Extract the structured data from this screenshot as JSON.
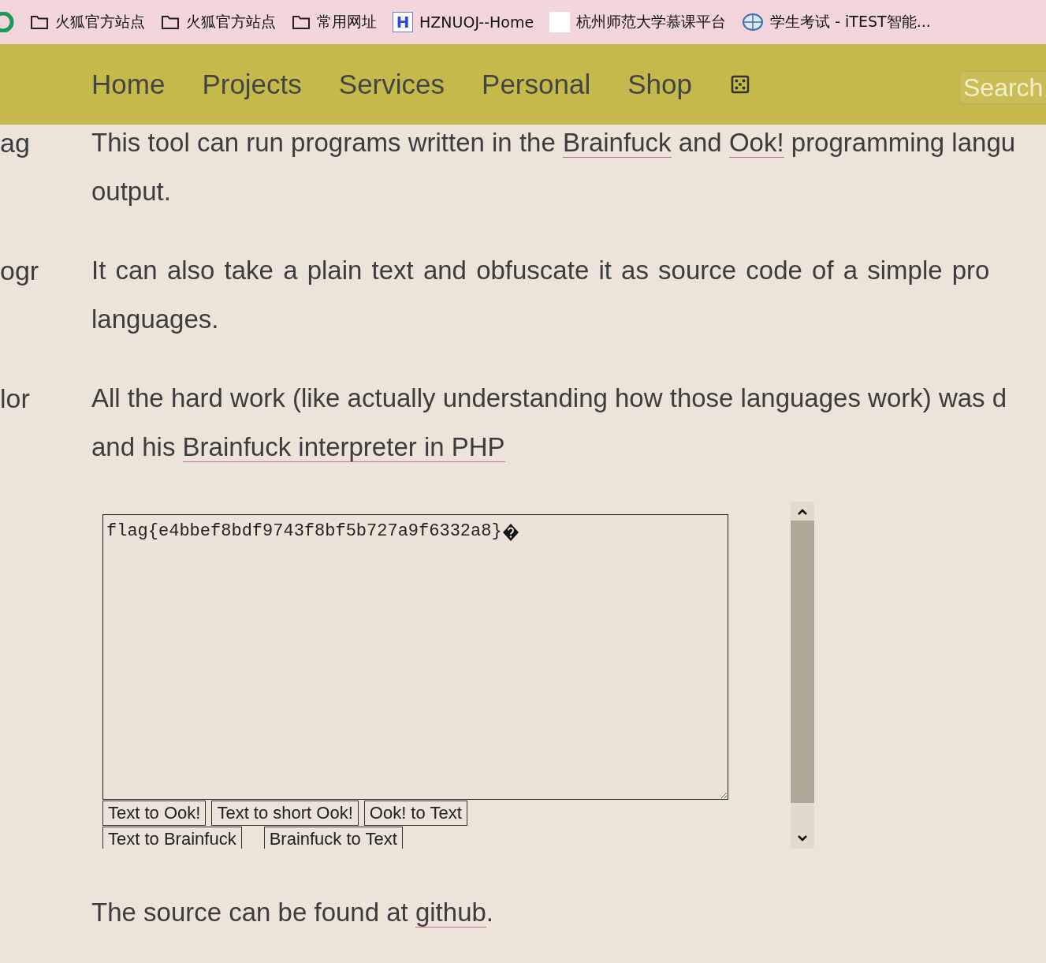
{
  "bookmarks": [
    {
      "kind": "folder",
      "label": "火狐官方站点"
    },
    {
      "kind": "folder",
      "label": "火狐官方站点"
    },
    {
      "kind": "folder",
      "label": "常用网址"
    },
    {
      "kind": "letter",
      "icon_text": "H",
      "label": "HZNUOJ--Home"
    },
    {
      "kind": "blank",
      "label": "杭州师范大学慕课平台"
    },
    {
      "kind": "globe",
      "label": "学生考试 - iTEST智能..."
    }
  ],
  "nav": {
    "items": [
      "Home",
      "Projects",
      "Services",
      "Personal",
      "Shop"
    ],
    "search": {
      "placeholder": "Search"
    }
  },
  "sidebar": {
    "fragments": [
      "ag",
      "ogr",
      "lor"
    ]
  },
  "paragraphs": [
    {
      "justify": false,
      "lines": [
        [
          {
            "kind": "text",
            "text": "This tool can run programs written in the "
          },
          {
            "kind": "link",
            "text": "Brainfuck"
          },
          {
            "kind": "text",
            "text": " and "
          },
          {
            "kind": "link",
            "text": "Ook!"
          },
          {
            "kind": "text",
            "text": " programming langu"
          }
        ],
        [
          {
            "kind": "text",
            "text": "output."
          }
        ]
      ]
    },
    {
      "justify": true,
      "lines": [
        [
          {
            "kind": "text",
            "text": "It can also take a plain text and obfuscate it as source code of a simple pro"
          }
        ],
        [
          {
            "kind": "text",
            "text": "languages."
          }
        ]
      ]
    },
    {
      "justify": false,
      "lines": [
        [
          {
            "kind": "text",
            "text": "All the hard work (like actually understanding how those languages work) was d"
          }
        ],
        [
          {
            "kind": "text",
            "text": "and his "
          },
          {
            "kind": "link",
            "text": "Brainfuck interpreter in PHP"
          }
        ]
      ]
    }
  ],
  "editor": {
    "value": "flag{e4bbef8bdf9743f8bf5b727a9f6332a8}",
    "buttons": [
      [
        "Text to Ook!",
        "Text to short Ook!",
        "Ook! to Text"
      ],
      [
        "Text to Brainfuck",
        "Brainfuck to Text"
      ]
    ]
  },
  "footer": [
    {
      "kind": "text",
      "text": "The source can be found at "
    },
    {
      "kind": "link",
      "text": "github"
    },
    {
      "kind": "text",
      "text": "."
    }
  ]
}
